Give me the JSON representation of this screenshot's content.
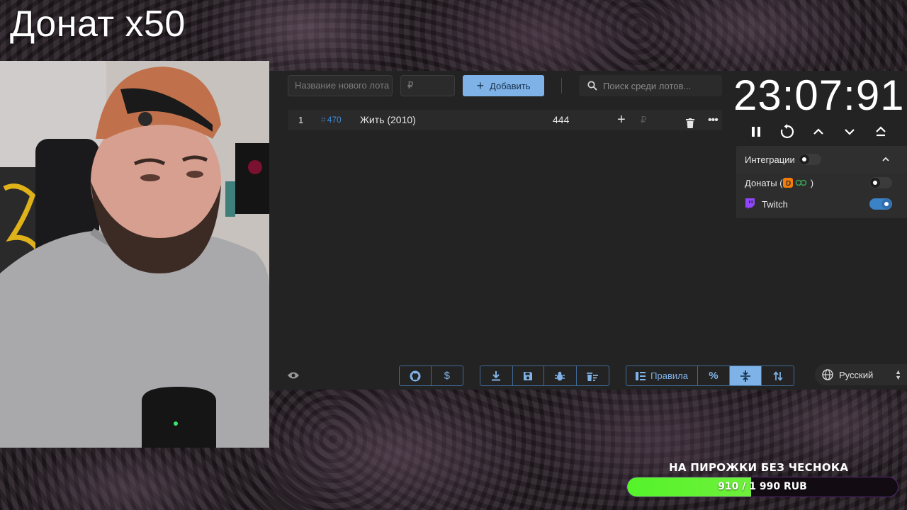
{
  "overlay": {
    "title": "Донат x50"
  },
  "auction": {
    "new_lot_placeholder": "Название нового лота",
    "amount_placeholder": "₽",
    "add_button_label": "Добавить",
    "search_placeholder": "Поиск среди лотов...",
    "lots": [
      {
        "position": "1",
        "id": "470",
        "id_prefix": "#",
        "name": "Жить (2010)",
        "amount": "444",
        "currency_placeholder": "₽"
      }
    ]
  },
  "timer": {
    "display": "23:07:91"
  },
  "integrations": {
    "header_label": "Интеграции",
    "enabled": false,
    "items": [
      {
        "label_prefix": "Донаты (",
        "label_suffix": " )",
        "enabled": false
      },
      {
        "label": "Twitch",
        "enabled": true
      }
    ]
  },
  "footer": {
    "rules_label": "Правила",
    "language": "Русский"
  },
  "donation_goal": {
    "title": "НА ПИРОЖКИ БЕЗ ЧЕСНОКА",
    "current": 910,
    "target": 1990,
    "progress_text": "910 / 1 990 RUB",
    "fraction": 0.457
  },
  "colors": {
    "accent": "#7fb3e8",
    "lot_id": "#3f8ad6",
    "toggle_on": "#3b82c6",
    "goal_fill": "#55f32a",
    "twitch": "#9146ff",
    "donationalerts": "#f57d07"
  }
}
